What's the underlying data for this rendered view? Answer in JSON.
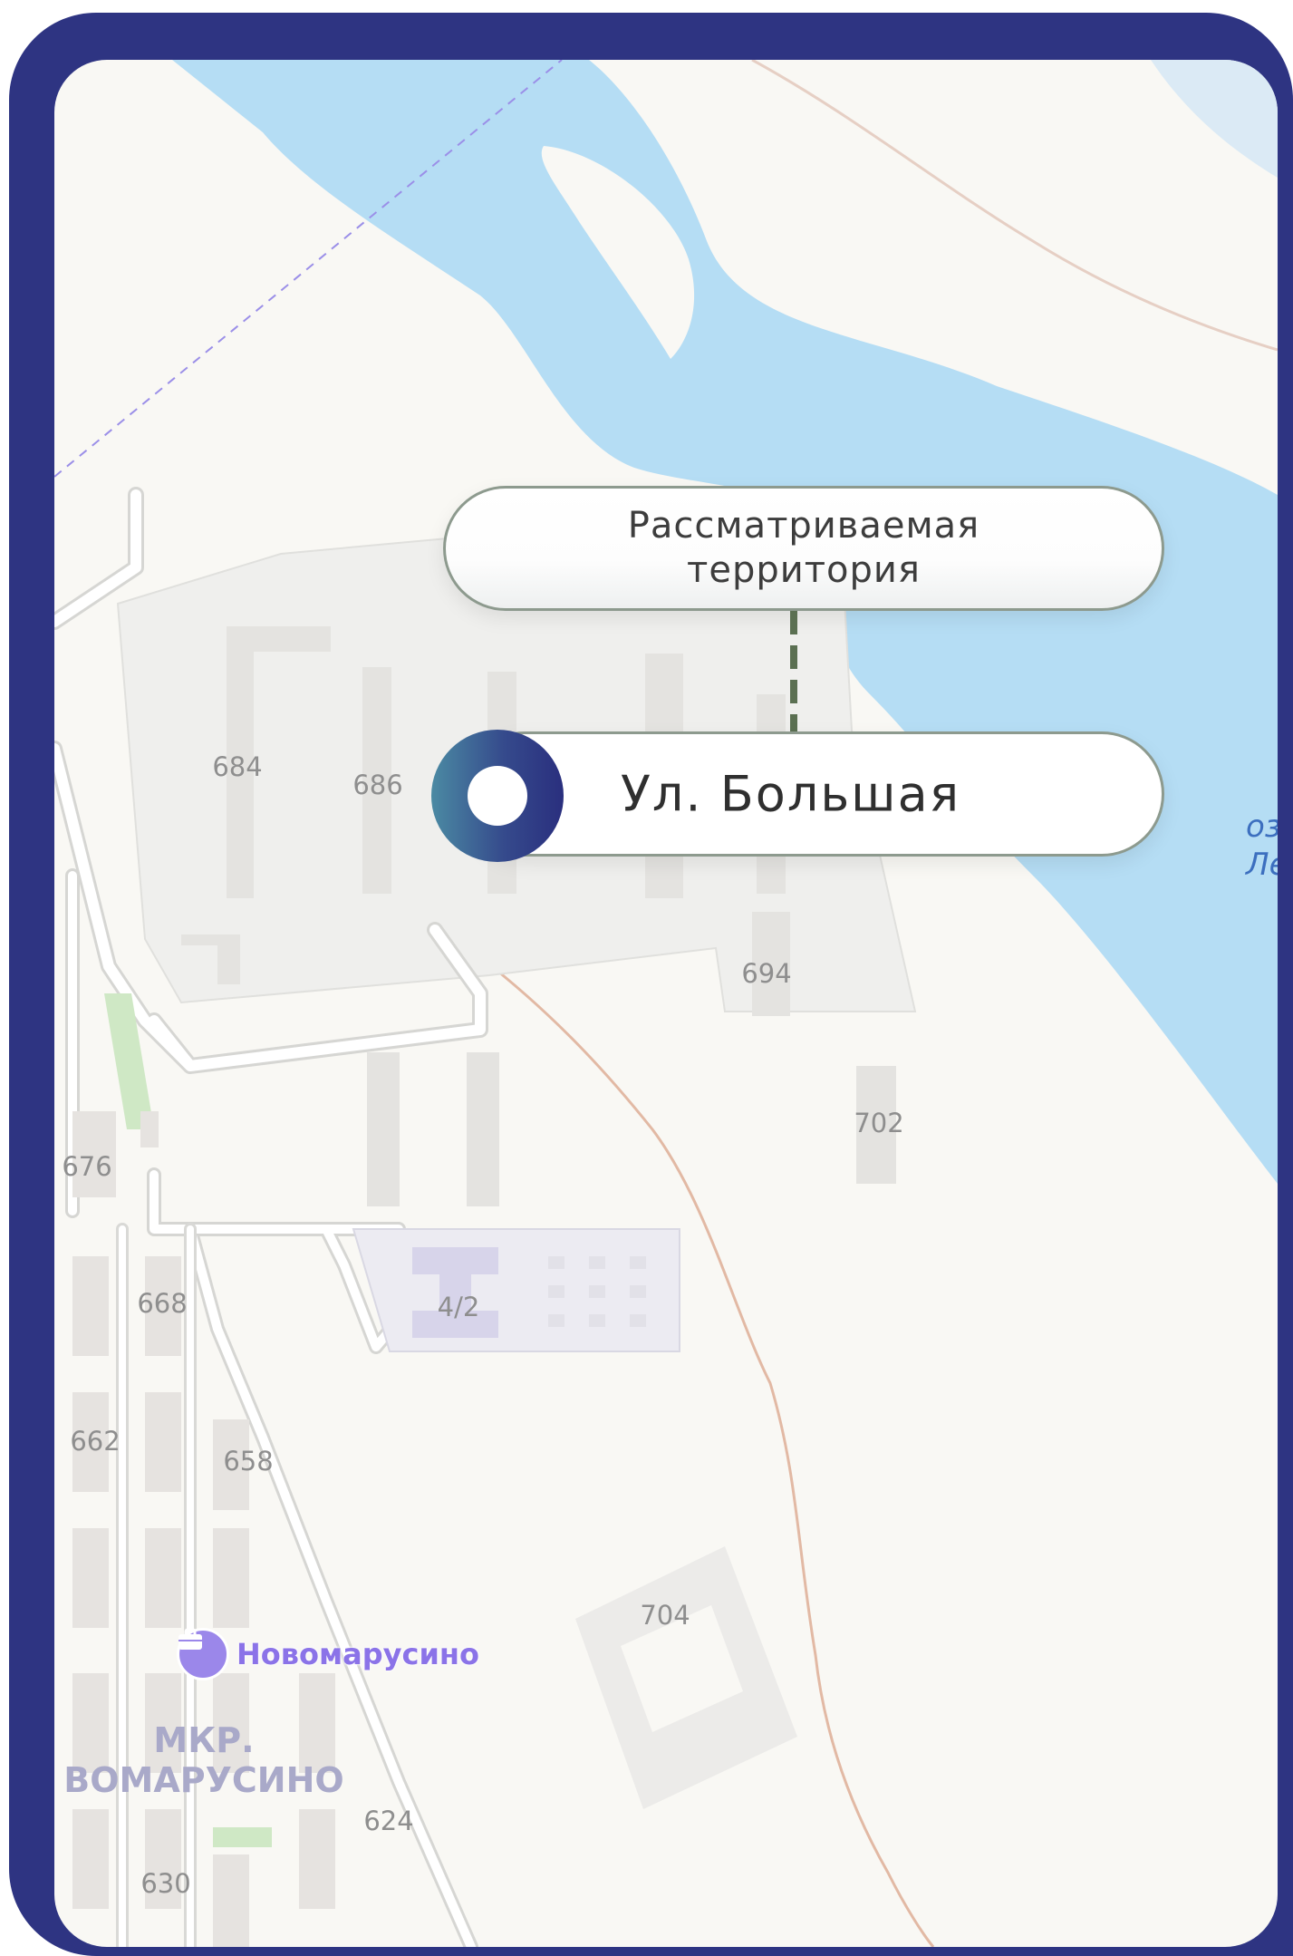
{
  "colors": {
    "frame": "#2e3482",
    "water": "#b5ddf4",
    "land": "#f9f8f4",
    "marker_gradient": [
      "#4b8aa3",
      "#2a2f7e"
    ],
    "connector": "#5b7052",
    "poi": "#8b73e8"
  },
  "callout": {
    "label": "Рассматриваемая\nтерритория"
  },
  "street_pill": {
    "label": "Ул. Большая",
    "icon": "location-marker-icon"
  },
  "map": {
    "lake_label": "оз.\nЛеньк",
    "building_labels": [
      "684",
      "686",
      "694",
      "702",
      "676",
      "668",
      "4/2",
      "662",
      "658",
      "704",
      "624",
      "630"
    ],
    "poi": {
      "name": "Новомарусино",
      "icon": "briefcase-icon"
    },
    "district_label": "МКР.\nВОМАРУСИНО"
  }
}
